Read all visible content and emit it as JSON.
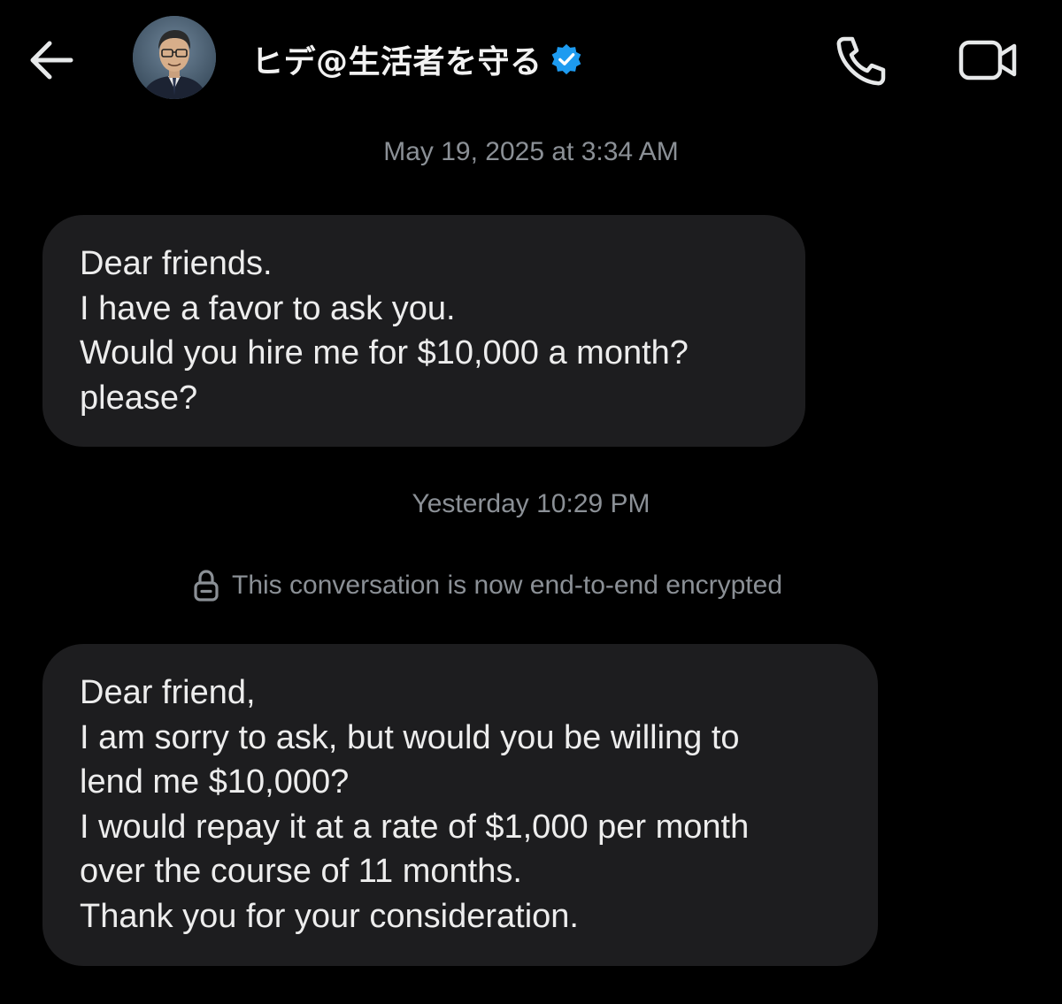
{
  "header": {
    "title": "ヒデ@生活者を守る",
    "verified": true,
    "icons": {
      "back": "back-arrow-icon",
      "verified": "verified-badge-icon",
      "call": "phone-icon",
      "video": "video-camera-icon"
    }
  },
  "conversation": {
    "timestamp_1": "May 19, 2025 at 3:34 AM",
    "message_1": {
      "lines": [
        "Dear friends.",
        "I have a favor to ask you.",
        "Would you hire me for $10,000 a month?",
        "please?"
      ]
    },
    "timestamp_2": "Yesterday 10:29 PM",
    "encrypted_notice": "This conversation is now end-to-end encrypted",
    "message_2": {
      "lines": [
        "Dear friend,",
        "I am sorry to ask, but would you be willing to",
        "lend me $10,000?",
        "I would repay it at a rate of $1,000 per month",
        "over the course of 11 months.",
        "Thank you for your consideration."
      ]
    }
  },
  "colors": {
    "background": "#000000",
    "bubble": "#1d1d1f",
    "muted_text": "#8b9096",
    "verified_blue": "#1d9bf0"
  }
}
